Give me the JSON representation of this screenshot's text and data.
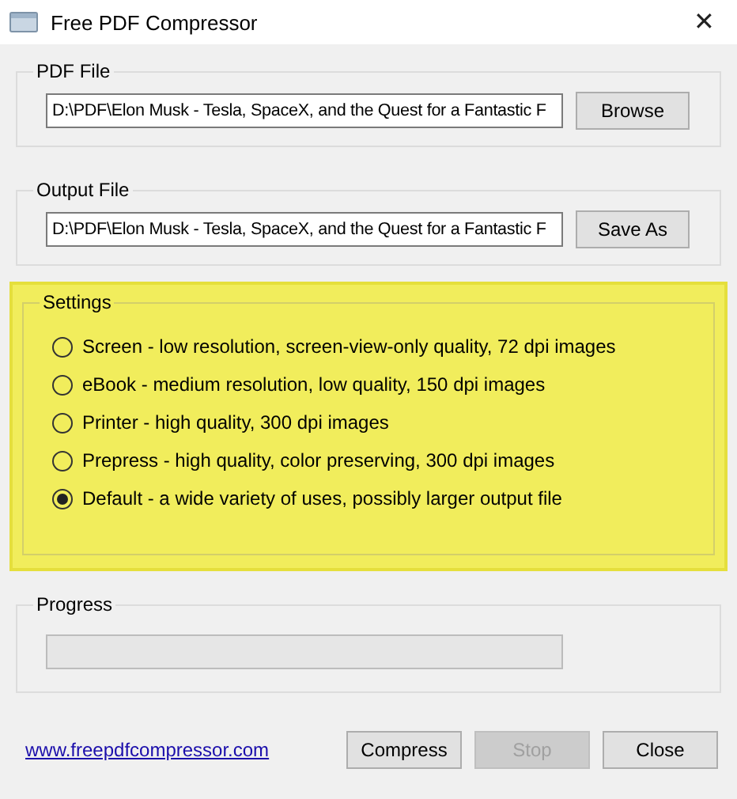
{
  "window": {
    "title": "Free PDF Compressor",
    "close": "✕"
  },
  "pdf_file": {
    "label": "PDF File",
    "value": "D:\\PDF\\Elon Musk - Tesla, SpaceX, and the Quest for a Fantastic F",
    "button": "Browse"
  },
  "output_file": {
    "label": "Output File",
    "value": "D:\\PDF\\Elon Musk - Tesla, SpaceX, and the Quest for a Fantastic F",
    "button": "Save As"
  },
  "settings": {
    "label": "Settings",
    "highlighted": true,
    "options": [
      {
        "label": "Screen - low resolution, screen-view-only quality, 72 dpi images",
        "selected": false
      },
      {
        "label": "eBook - medium resolution, low quality, 150 dpi images",
        "selected": false
      },
      {
        "label": "Printer - high quality, 300 dpi images",
        "selected": false
      },
      {
        "label": "Prepress - high quality, color preserving, 300 dpi images",
        "selected": false
      },
      {
        "label": "Default - a wide variety of uses, possibly larger output file",
        "selected": true
      }
    ]
  },
  "progress": {
    "label": "Progress",
    "level": 0
  },
  "footer": {
    "link": "www.freepdfcompressor.com",
    "buttons": [
      {
        "label": "Compress",
        "disabled": false
      },
      {
        "label": "Stop",
        "disabled": true
      },
      {
        "label": "Close",
        "disabled": false
      }
    ]
  }
}
